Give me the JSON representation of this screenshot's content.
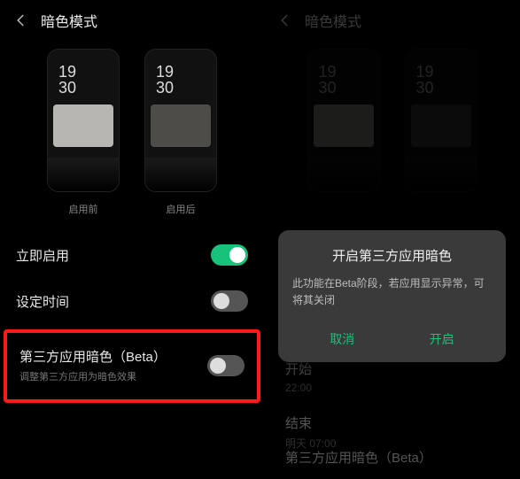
{
  "left": {
    "title": "暗色模式",
    "preview": {
      "time": "19\n30",
      "before_caption": "启用前",
      "after_caption": "启用后"
    },
    "rows": {
      "enable_now": "立即启用",
      "schedule": "设定时间",
      "beta_title": "第三方应用暗色（Beta）",
      "beta_sub": "调整第三方应用为暗色效果"
    },
    "toggles": {
      "enable_now": true,
      "schedule": false,
      "beta": false
    }
  },
  "right": {
    "title": "暗色模式",
    "dialog": {
      "title": "开启第三方应用暗色",
      "body": "此功能在Beta阶段，若应用显示异常，可将其关闭",
      "cancel": "取消",
      "confirm": "开启"
    },
    "rows": {
      "start_label": "开始",
      "start_value": "22:00",
      "end_label": "结束",
      "end_value": "明天 07:00",
      "beta_title": "第三方应用暗色（Beta）"
    }
  }
}
